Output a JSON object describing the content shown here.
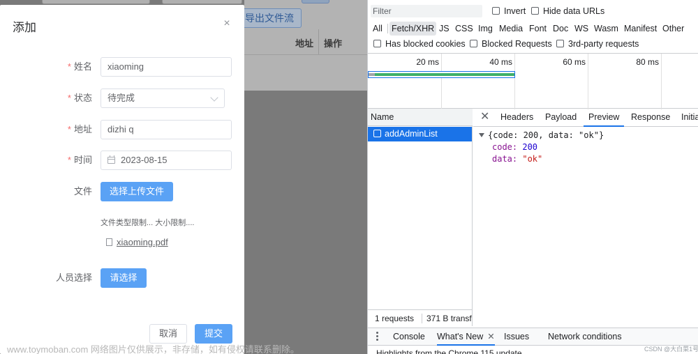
{
  "app": {
    "export_button": "导出文件流",
    "table_headers": {
      "address": "地址",
      "operation": "操作"
    }
  },
  "dialog": {
    "title": "添加",
    "fields": {
      "name": {
        "label": "姓名",
        "value": "xiaoming"
      },
      "status": {
        "label": "状态",
        "value": "待完成"
      },
      "address": {
        "label": "地址",
        "value": "dizhi q"
      },
      "time": {
        "label": "时间",
        "value": "2023-08-15"
      },
      "file": {
        "label": "文件",
        "button": "选择上传文件",
        "hint": "文件类型限制... 大小限制....",
        "filename": "xiaoming.pdf"
      },
      "person": {
        "label": "人员选择",
        "button": "请选择"
      }
    },
    "required_mark": "*",
    "cancel_label": "取消",
    "submit_label": "提交",
    "close_glyph": "×"
  },
  "watermark": "www.toymoban.com 网络图片仅供展示，非存储，如有侵权请联系删除。",
  "devtools": {
    "filter_placeholder": "Filter",
    "invert_label": "Invert",
    "hide_data_urls_label": "Hide data URLs",
    "types": [
      "All",
      "Fetch/XHR",
      "JS",
      "CSS",
      "Img",
      "Media",
      "Font",
      "Doc",
      "WS",
      "Wasm",
      "Manifest",
      "Other"
    ],
    "active_type": "Fetch/XHR",
    "blocked_cookies_label": "Has blocked cookies",
    "blocked_requests_label": "Blocked Requests",
    "third_party_label": "3rd-party requests",
    "timeline_labels": [
      "20 ms",
      "40 ms",
      "60 ms",
      "80 ms"
    ],
    "name_header": "Name",
    "request_name": "addAdminList",
    "requests_count": "1 requests",
    "transferred": "371 B transf",
    "detail_tabs": [
      "Headers",
      "Payload",
      "Preview",
      "Response",
      "Initia"
    ],
    "active_detail_tab": "Preview",
    "preview": {
      "summary": "{code: 200, data: \"ok\"}",
      "code_key": "code:",
      "code_value": "200",
      "data_key": "data:",
      "data_value": "\"ok\""
    },
    "drawer_tabs": {
      "console": "Console",
      "whats_new": "What's New",
      "issues": "Issues",
      "network_conditions": "Network conditions"
    },
    "drawer_content": "Highlights from the Chrome 115 update",
    "corner_mark": "CSDN @大白菜1号"
  }
}
